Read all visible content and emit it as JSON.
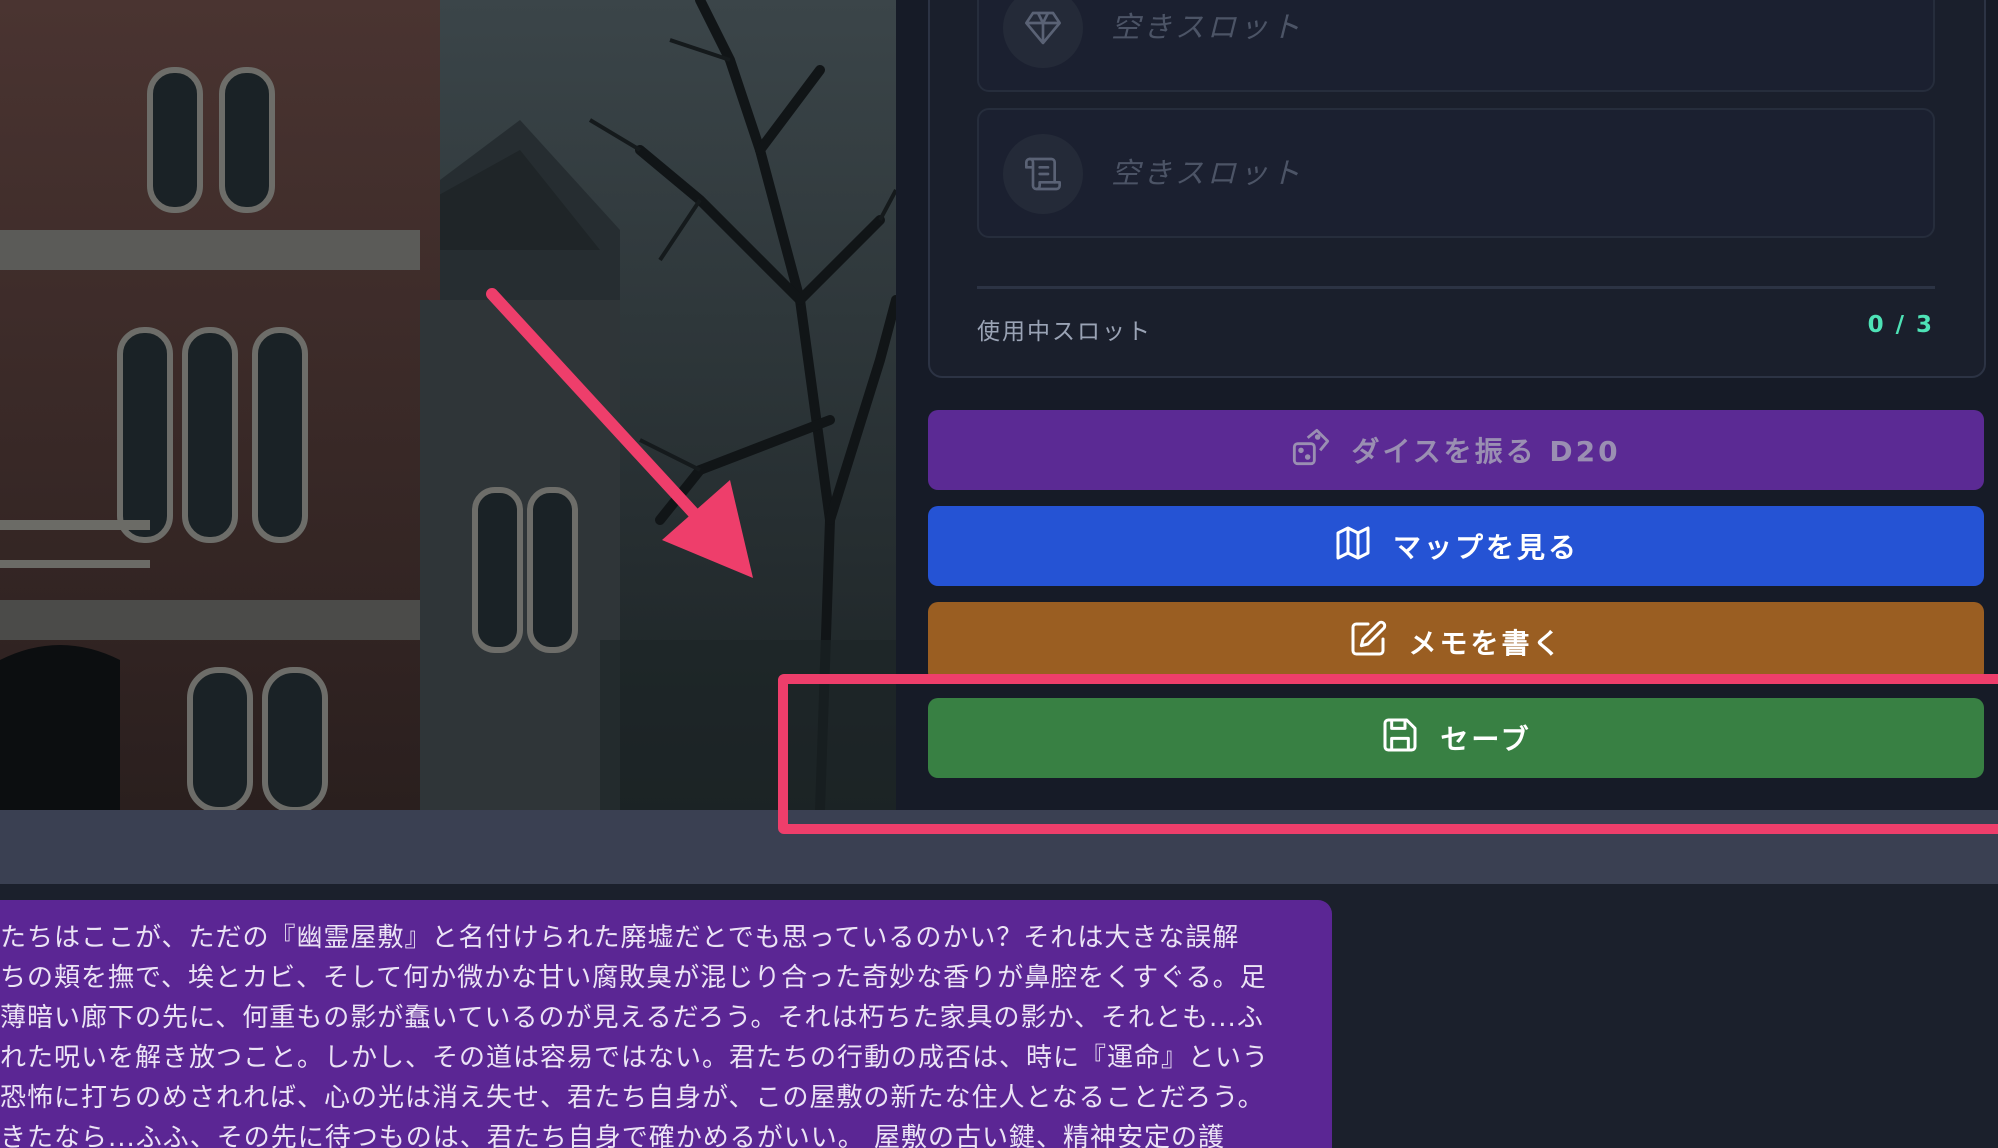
{
  "inventory": {
    "slots": [
      {
        "icon": "gem-icon",
        "placeholder": "空きスロット"
      },
      {
        "icon": "scroll-icon",
        "placeholder": "空きスロット"
      }
    ],
    "usage_label": "使用中スロット",
    "usage_value": "0 / 3"
  },
  "actions": {
    "dice_label": "ダイスを振る D20",
    "map_label": "マップを見る",
    "memo_label": "メモを書く",
    "save_label": "セーブ"
  },
  "narration": {
    "lines": [
      "たちはここが、ただの『幽霊屋敷』と名付けられた廃墟だとでも思っているのかい？それは大きな誤解",
      "ちの頬を撫で、埃とカビ、そして何か微かな甘い腐敗臭が混じり合った奇妙な香りが鼻腔をくすぐる。足",
      "薄暗い廊下の先に、何重もの影が蠢いているのが見えるだろう。それは朽ちた家具の影か、それとも...ふ",
      "れた呪いを解き放つこと。しかし、その道は容易ではない。君たちの行動の成否は、時に『運命』という",
      "恐怖に打ちのめされれば、心の光は消え失せ、君たち自身が、この屋敷の新たな住人となることだろう。",
      "きたなら...ふふ、その先に待つものは、君たち自身で確かめるがいい。 屋敷の古い鍵、精神安定の護"
    ]
  },
  "colors": {
    "dice": "#5b2a94",
    "map": "#2553d4",
    "memo": "#9a5e22",
    "save": "#388043",
    "highlight": "#ee3e6b",
    "usage_value": "#4ee2b6"
  }
}
